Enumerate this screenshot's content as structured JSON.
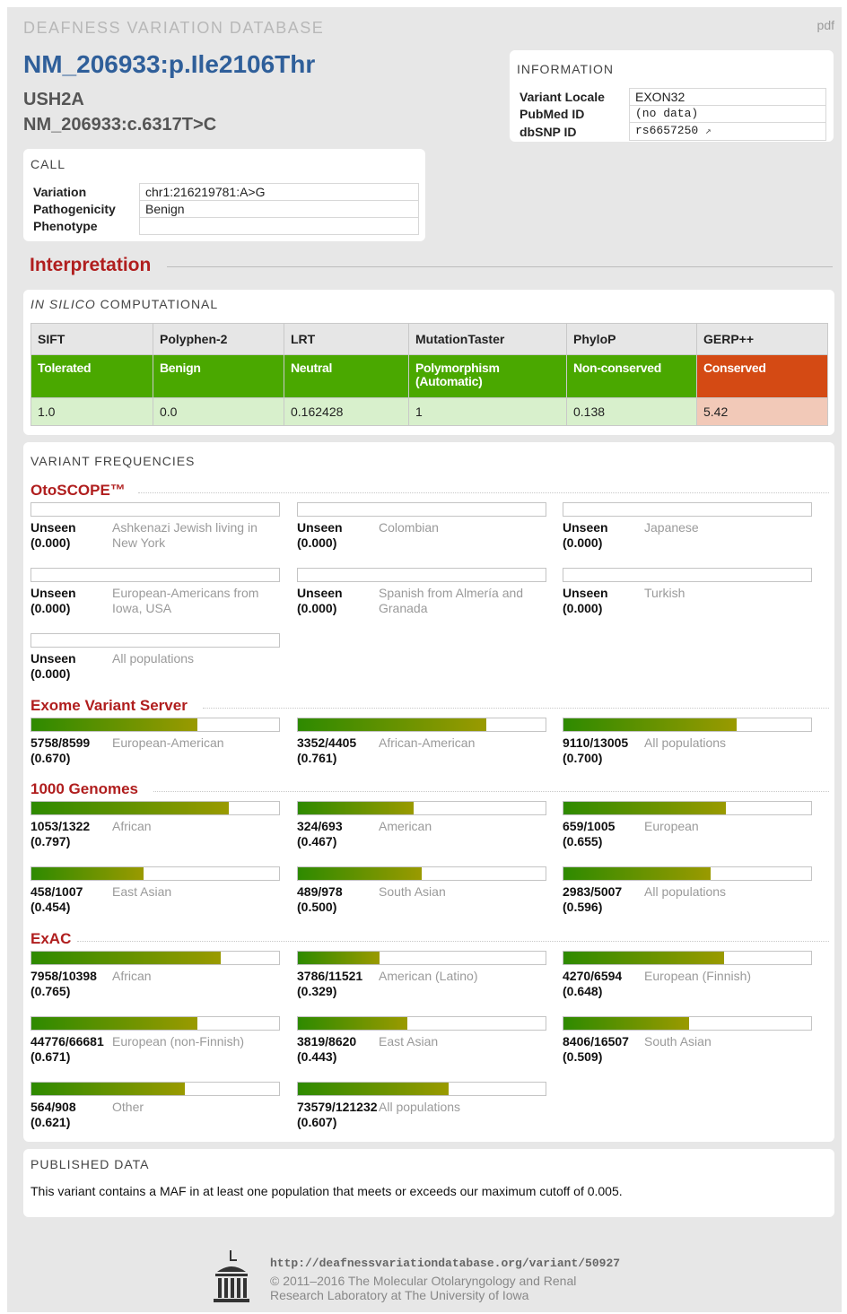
{
  "header": {
    "site_name": "DEAFNESS VARIATION DATABASE",
    "pdf_link": "pdf",
    "variant_title": "NM_206933:p.Ile2106Thr",
    "gene": "USH2A",
    "cdna": "NM_206933:c.6317T>C"
  },
  "information": {
    "heading": "INFORMATION",
    "rows": [
      {
        "label": "Variant Locale",
        "value": "EXON32"
      },
      {
        "label": "PubMed ID",
        "value": "(no data)"
      },
      {
        "label": "dbSNP ID",
        "value": "rs6657250"
      }
    ]
  },
  "call": {
    "heading": "CALL",
    "rows": [
      {
        "label": "Variation",
        "value": "chr1:216219781:A>G"
      },
      {
        "label": "Pathogenicity",
        "value": "Benign"
      },
      {
        "label": "Phenotype",
        "value": ""
      }
    ]
  },
  "interpretation": {
    "heading": "Interpretation",
    "in_silico": {
      "heading_italic": "IN SILICO",
      "heading_rest": " COMPUTATIONAL",
      "tools": [
        {
          "name": "SIFT",
          "call": "Tolerated",
          "score": "1.0",
          "status": "benign"
        },
        {
          "name": "Polyphen-2",
          "call": "Benign",
          "score": "0.0",
          "status": "benign"
        },
        {
          "name": "LRT",
          "call": "Neutral",
          "score": "0.162428",
          "status": "benign"
        },
        {
          "name": "MutationTaster",
          "call": "Polymorphism (Automatic)",
          "score": "1",
          "status": "benign"
        },
        {
          "name": "PhyloP",
          "call": "Non-conserved",
          "score": "0.138",
          "status": "benign"
        },
        {
          "name": "GERP++",
          "call": "Conserved",
          "score": "5.42",
          "status": "damaging"
        }
      ]
    }
  },
  "frequencies": {
    "heading": "VARIANT FREQUENCIES",
    "otoscope": {
      "name": "OtoSCOPE™",
      "entries": [
        {
          "count": "Unseen",
          "freq": "(0.000)",
          "pop": "Ashkenazi Jewish living in New York",
          "value": 0
        },
        {
          "count": "Unseen",
          "freq": "(0.000)",
          "pop": "Colombian",
          "value": 0
        },
        {
          "count": "Unseen",
          "freq": "(0.000)",
          "pop": "Japanese",
          "value": 0
        },
        {
          "count": "Unseen",
          "freq": "(0.000)",
          "pop": "European-Americans from Iowa, USA",
          "value": 0
        },
        {
          "count": "Unseen",
          "freq": "(0.000)",
          "pop": "Spanish from Almería and Granada",
          "value": 0
        },
        {
          "count": "Unseen",
          "freq": "(0.000)",
          "pop": "Turkish",
          "value": 0
        },
        {
          "count": "Unseen",
          "freq": "(0.000)",
          "pop": "All populations",
          "value": 0
        }
      ]
    },
    "evs": {
      "name": "Exome Variant Server",
      "entries": [
        {
          "count": "5758/8599",
          "freq": "(0.670)",
          "pop": "European-American",
          "value": 0.67
        },
        {
          "count": "3352/4405",
          "freq": "(0.761)",
          "pop": "African-American",
          "value": 0.761
        },
        {
          "count": "9110/13005",
          "freq": "(0.700)",
          "pop": "All populations",
          "value": 0.7
        }
      ]
    },
    "kg": {
      "name": "1000 Genomes",
      "entries": [
        {
          "count": "1053/1322",
          "freq": "(0.797)",
          "pop": "African",
          "value": 0.797
        },
        {
          "count": "324/693",
          "freq": "(0.467)",
          "pop": "American",
          "value": 0.467
        },
        {
          "count": "659/1005",
          "freq": "(0.655)",
          "pop": "European",
          "value": 0.655
        },
        {
          "count": "458/1007",
          "freq": "(0.454)",
          "pop": "East Asian",
          "value": 0.454
        },
        {
          "count": "489/978",
          "freq": "(0.500)",
          "pop": "South Asian",
          "value": 0.5
        },
        {
          "count": "2983/5007",
          "freq": "(0.596)",
          "pop": "All populations",
          "value": 0.596
        }
      ]
    },
    "exac": {
      "name": "ExAC",
      "entries": [
        {
          "count": "7958/10398",
          "freq": "(0.765)",
          "pop": "African",
          "value": 0.765
        },
        {
          "count": "3786/11521",
          "freq": "(0.329)",
          "pop": "American (Latino)",
          "value": 0.329
        },
        {
          "count": "4270/6594",
          "freq": "(0.648)",
          "pop": "European (Finnish)",
          "value": 0.648
        },
        {
          "count": "44776/66681",
          "freq": "(0.671)",
          "pop": "European (non-Finnish)",
          "value": 0.671
        },
        {
          "count": "3819/8620",
          "freq": "(0.443)",
          "pop": "East Asian",
          "value": 0.443
        },
        {
          "count": "8406/16507",
          "freq": "(0.509)",
          "pop": "South Asian",
          "value": 0.509
        },
        {
          "count": "564/908",
          "freq": "(0.621)",
          "pop": "Other",
          "value": 0.621
        },
        {
          "count": "73579/121232",
          "freq": "(0.607)",
          "pop": "All populations",
          "value": 0.607
        }
      ]
    }
  },
  "published": {
    "heading": "PUBLISHED DATA",
    "text": "This variant contains a MAF in at least one population that meets or exceeds our maximum cutoff of 0.005."
  },
  "footer": {
    "url": "http://deafnessvariationdatabase.org/variant/50927",
    "line1": "© 2011–2016 The Molecular Otolaryngology and Renal",
    "line2": "Research Laboratory at The University of Iowa"
  },
  "colors": {
    "title_blue": "#2f5f9a",
    "section_red": "#b01e1e",
    "benign_green": "#4aa800",
    "damaging_orange": "#d44a14"
  }
}
